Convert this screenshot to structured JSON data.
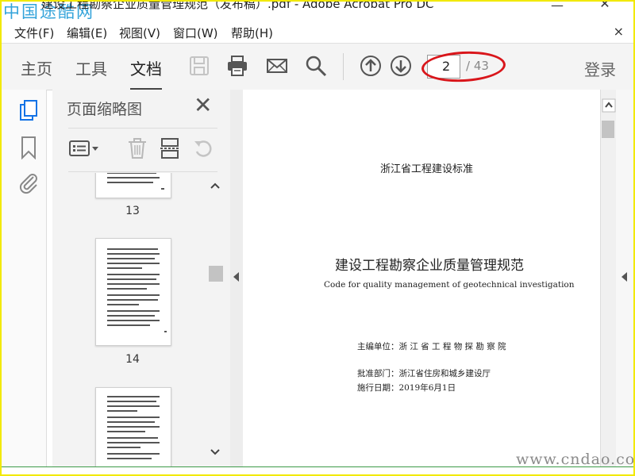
{
  "window": {
    "title": "建设工程勘察企业质量管理规范（发布稿）.pdf - Adobe Acrobat Pro DC",
    "minimize_glyph": "—",
    "maximize_glyph": "☐",
    "close_glyph": "✕"
  },
  "watermark": {
    "top": "中国途酷网",
    "bottom": "www.cndao.com"
  },
  "menu": {
    "items": [
      {
        "label": "文件(F)"
      },
      {
        "label": "编辑(E)"
      },
      {
        "label": "视图(V)"
      },
      {
        "label": "窗口(W)"
      },
      {
        "label": "帮助(H)"
      }
    ],
    "close_glyph": "×"
  },
  "toolbar": {
    "tabs": [
      {
        "label": "主页",
        "active": false
      },
      {
        "label": "工具",
        "active": false
      },
      {
        "label": "文档",
        "active": true
      }
    ],
    "icons": [
      "save-icon",
      "print-icon",
      "email-icon",
      "search-icon",
      "previous-page-icon",
      "next-page-icon"
    ],
    "page_input_value": "2",
    "page_total": "/ 43",
    "login_label": "登录",
    "highlight_color": "#d9161b"
  },
  "left_rail": {
    "icons": [
      "page-thumbnails-icon",
      "bookmarks-icon",
      "attachments-icon"
    ],
    "active_color": "#1473e6"
  },
  "thumbnail_panel": {
    "title": "页面缩略图",
    "close_glyph": "✕",
    "tools": [
      "thumbnail-options-icon",
      "delete-page-icon",
      "insert-page-icon",
      "rotate-page-icon"
    ],
    "pages": [
      {
        "label": "13"
      },
      {
        "label": "14"
      },
      {
        "label": ""
      }
    ]
  },
  "document": {
    "standard_title": "浙江省工程建设标准",
    "main_title": "建设工程勘察企业质量管理规范",
    "english_title": "Code for quality management of geotechnical investigation",
    "editor_line": "主编单位：浙 江 省 工 程 物 探 勘 察 院",
    "approver_line": "批准部门：浙江省住房和城乡建设厅",
    "date_line": "施行日期：2019年6月1日"
  }
}
